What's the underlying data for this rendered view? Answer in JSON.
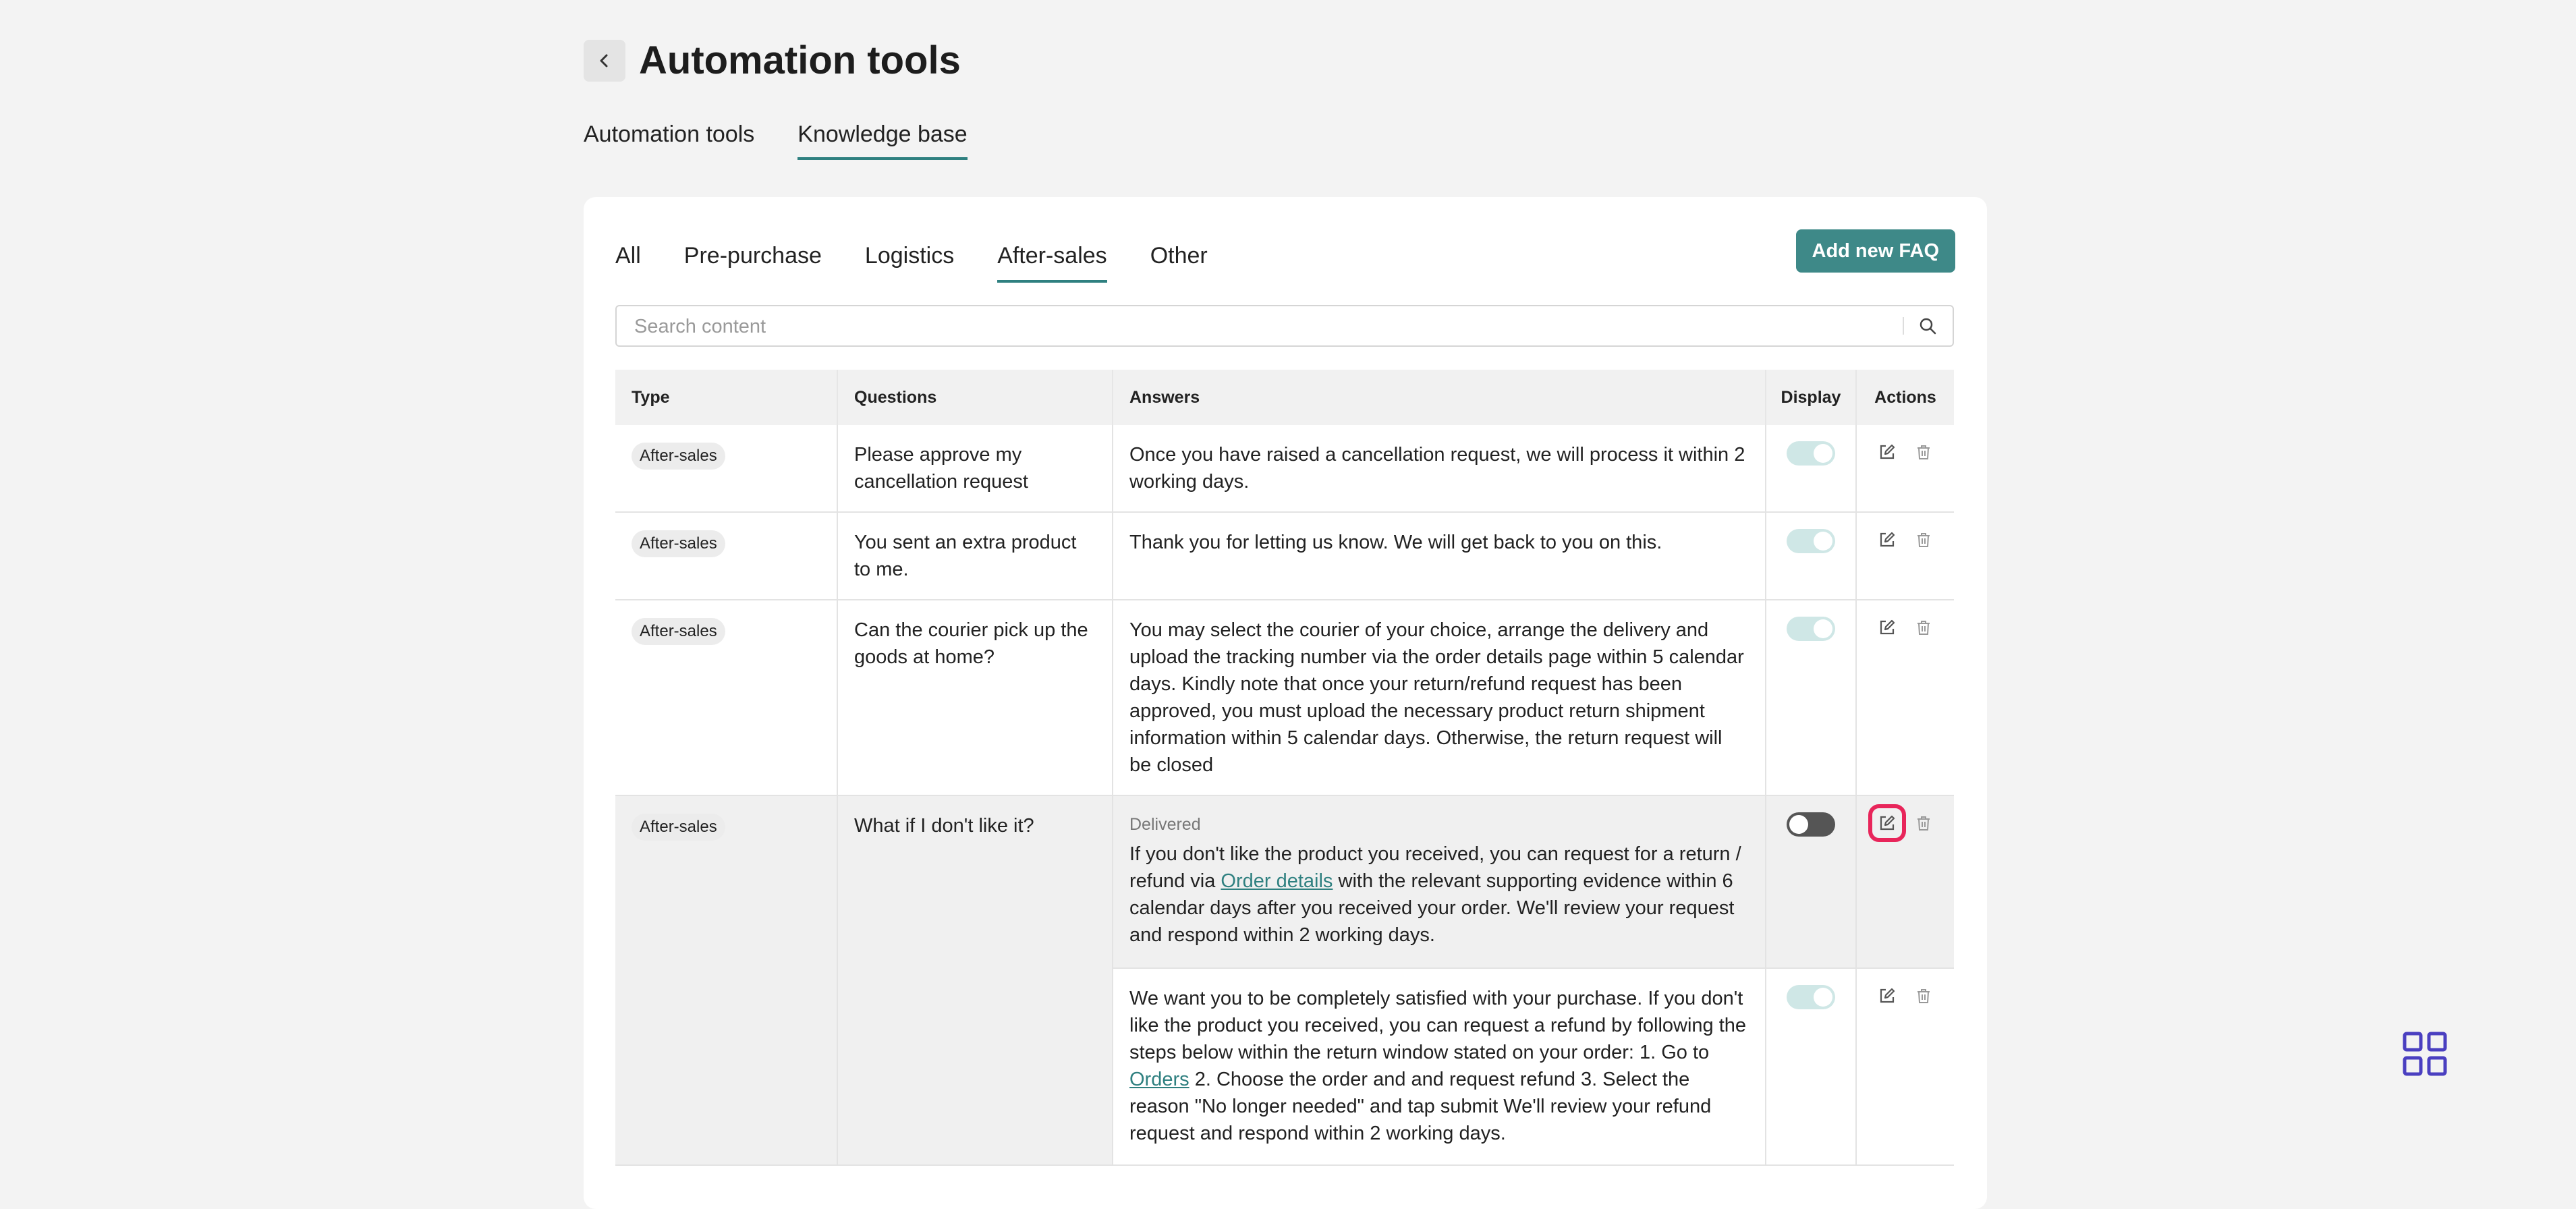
{
  "header": {
    "title": "Automation tools",
    "back_icon": "chevron-left-icon"
  },
  "main_tabs": [
    {
      "label": "Automation tools",
      "active": false
    },
    {
      "label": "Knowledge base",
      "active": true
    }
  ],
  "sub_tabs": [
    {
      "label": "All",
      "active": false
    },
    {
      "label": "Pre-purchase",
      "active": false
    },
    {
      "label": "Logistics",
      "active": false
    },
    {
      "label": "After-sales",
      "active": true
    },
    {
      "label": "Other",
      "active": false
    }
  ],
  "add_button": "Add new FAQ",
  "search": {
    "placeholder": "Search content",
    "value": ""
  },
  "table": {
    "columns": [
      "Type",
      "Questions",
      "Answers",
      "Display",
      "Actions"
    ],
    "rows": [
      {
        "type": "After-sales",
        "question": "Please approve my cancellation request",
        "answer": "Once you have raised a cancellation request, we will process it within 2 working days.",
        "display": true
      },
      {
        "type": "After-sales",
        "question": "You sent an extra product to me.",
        "answer": "Thank you for letting us know. We will get back to you on this.",
        "display": true
      },
      {
        "type": "After-sales",
        "question": "Can the courier pick up the goods at home?",
        "answer": "You may select the courier of your choice, arrange the delivery and upload the tracking number via the order details page within 5 calendar days. Kindly note that once your return/refund request has been approved, you must upload the necessary product return shipment information within 5 calendar days. Otherwise, the return request will be closed",
        "display": true
      }
    ],
    "group_row": {
      "type": "After-sales",
      "question": "What if I don't like it?",
      "answers": [
        {
          "label": "Delivered",
          "text_before": "If you don't like the product you received, you can request for a return / refund via ",
          "link": "Order details",
          "text_after": " with the relevant supporting evidence within 6 calendar days after you received your order. We'll review your request and respond within 2 working days.",
          "display": false
        },
        {
          "text_before": "We want you to be completely satisfied with your purchase. If you don't like the product you received, you can request a refund by following the steps below within the return window stated on your order: 1. Go to ",
          "link": "Orders",
          "text_after": " 2. Choose the order and and request refund 3. Select the reason \"No longer needed\" and tap submit We'll review your refund request and respond within 2 working days.",
          "display": true
        }
      ]
    }
  },
  "icons": {
    "search": "search-icon",
    "edit": "edit-icon",
    "delete": "trash-icon",
    "apps": "app-grid-icon"
  },
  "colors": {
    "accent": "#3e8988",
    "highlight": "#e8255a",
    "app_grid": "#4a3fc0"
  }
}
